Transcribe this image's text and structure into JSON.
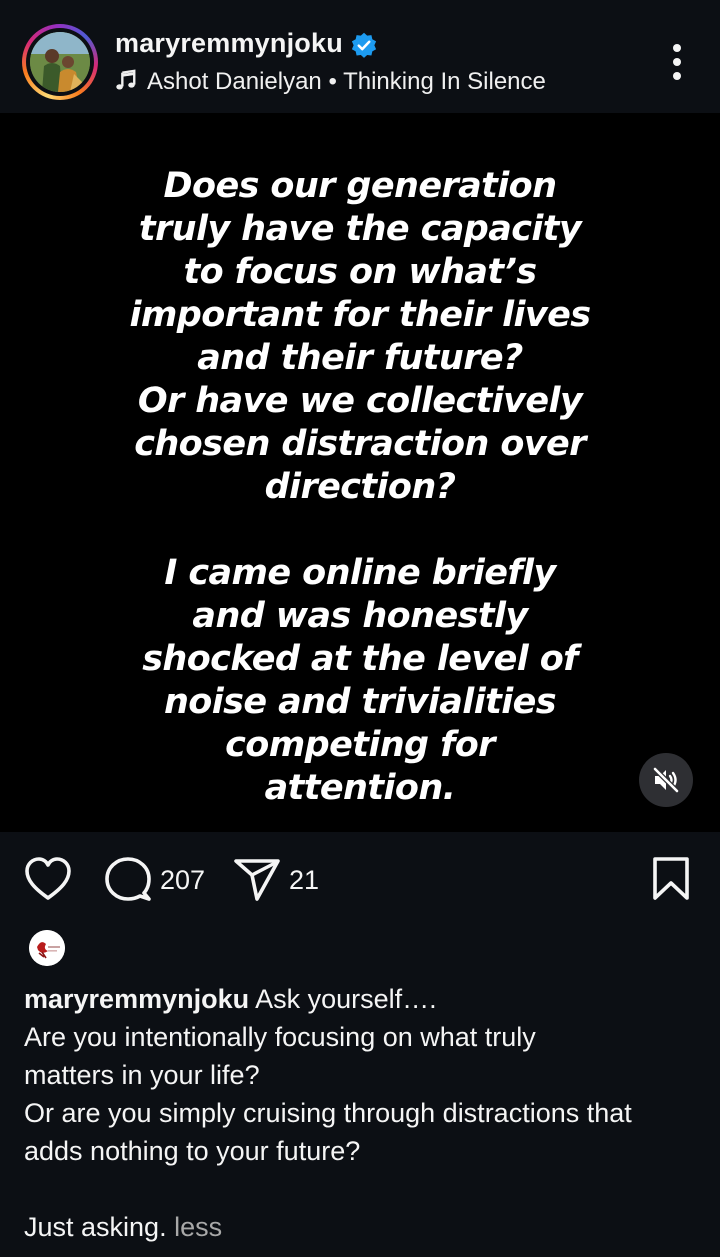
{
  "header": {
    "username": "maryremmynjoku",
    "audio_artist": "Ashot Danielyan",
    "audio_separator": "•",
    "audio_title": "Thinking In Silence"
  },
  "media": {
    "story_lines": [
      "Does our generation",
      "truly have the capacity",
      "to focus on what’s",
      "important for their lives",
      "and their future?",
      "Or have we collectively",
      "chosen distraction over",
      "direction?",
      "",
      "I came online briefly",
      "and was honestly",
      "shocked at the level of",
      "noise and trivialities",
      "competing for",
      "attention."
    ]
  },
  "actions": {
    "comment_count": "207",
    "share_count": "21"
  },
  "caption": {
    "username": "maryremmynjoku",
    "first_line": "Ask yourself….",
    "lines": [
      "Are you intentionally focusing on what truly",
      "matters in your life?",
      "Or are you simply cruising through distractions that",
      "adds nothing to your future?"
    ],
    "last_line": "Just asking.",
    "less_label": "less"
  },
  "colors": {
    "background": "#0c0f14",
    "media_background": "#000000",
    "verified_blue": "#1d9bf0",
    "muted_text": "#a8a8a8"
  },
  "icons": [
    "verified-badge-icon",
    "music-note-icon",
    "more-options-icon",
    "muted-speaker-icon",
    "heart-icon",
    "comment-bubble-icon",
    "share-send-icon",
    "bookmark-icon"
  ]
}
